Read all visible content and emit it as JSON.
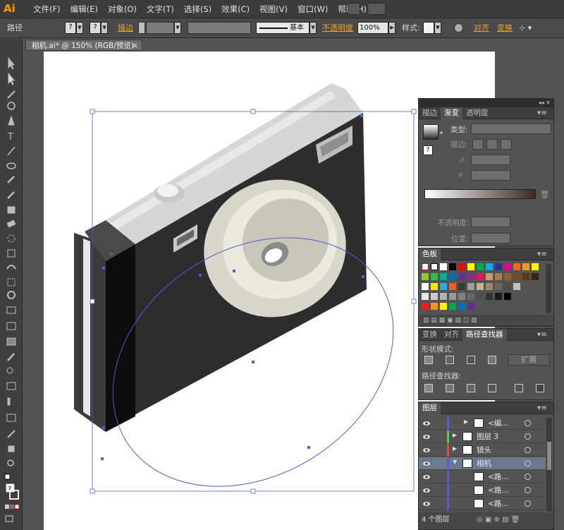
{
  "app": {
    "logo": "Ai"
  },
  "menu": [
    "文件(F)",
    "编辑(E)",
    "对象(O)",
    "文字(T)",
    "选择(S)",
    "效果(C)",
    "视图(V)",
    "窗口(W)",
    "帮助(H)"
  ],
  "control": {
    "object_type": "路径",
    "fill_unknown": "?",
    "stroke_unknown": "?",
    "stroke_label": "描边",
    "stroke_profile": "基本",
    "opacity_label": "不透明度",
    "opacity_value": "100%",
    "style_label": "样式:",
    "align_label": "对齐",
    "transform_label": "变换"
  },
  "document_tab": {
    "title": "相机.ai* @ 150% (RGB/预览)",
    "close": "×"
  },
  "gradient_panel": {
    "tabs": [
      "描边",
      "渐变",
      "透明度"
    ],
    "active_tab": "渐变",
    "type_label": "类型:",
    "stroke_label": "描边:",
    "opacity_label": "不透明度:",
    "position_label": "位置:",
    "unknown": "?"
  },
  "swatches_panel": {
    "tab": "色板"
  },
  "pathfinder_panel": {
    "tabs": [
      "变换",
      "对齐",
      "路径查找器"
    ],
    "active_tab": "路径查找器",
    "shape_modes_label": "形状模式:",
    "pathfinders_label": "路径查找器:",
    "expand_button": "扩展"
  },
  "layers_panel": {
    "tab": "图层",
    "rows": [
      {
        "name": "<编...",
        "indent": 1,
        "color": "#5a5ad8"
      },
      {
        "name": "图层 3",
        "indent": 0,
        "color": "#4fd04f"
      },
      {
        "name": "镜头",
        "indent": 0,
        "color": "#e04a4a"
      },
      {
        "name": "相机",
        "indent": 0,
        "color": "#5a5ad8",
        "selected": true
      },
      {
        "name": "<路...",
        "indent": 1,
        "color": "#5a5ad8"
      },
      {
        "name": "<路...",
        "indent": 1,
        "color": "#5a5ad8"
      },
      {
        "name": "<路...",
        "indent": 1,
        "color": "#5a5ad8"
      }
    ],
    "footer": "4 个图层"
  },
  "colors": {
    "accent_orange": "#f0a030",
    "selection_blue": "#4a60c8",
    "camera_body": "#2b2b2b",
    "camera_top": "#d0d0d0"
  }
}
